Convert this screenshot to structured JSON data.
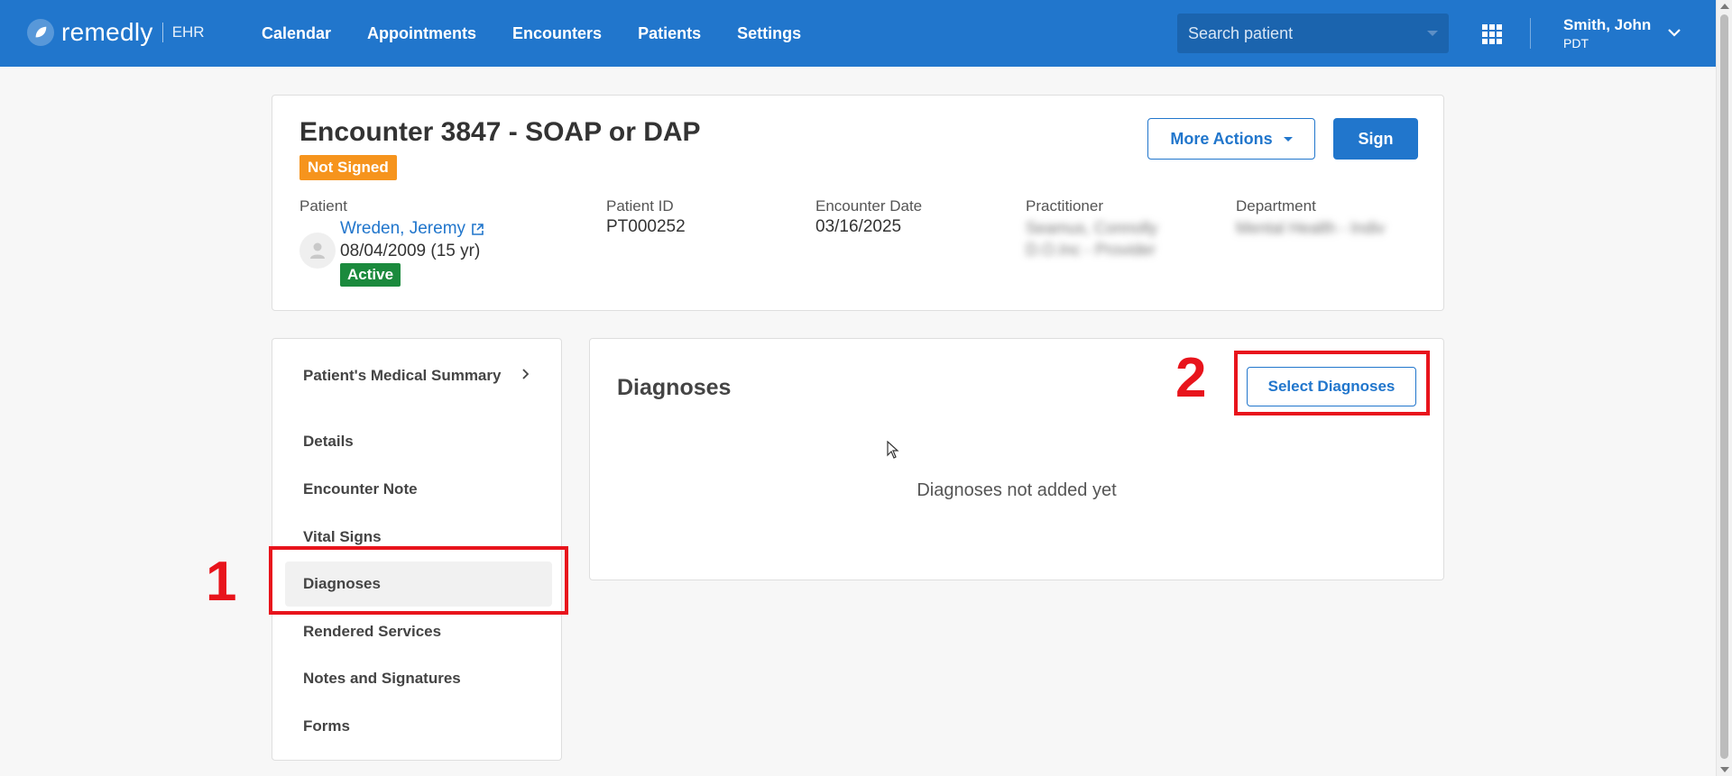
{
  "app": {
    "logo_text": "remedly",
    "logo_sub": "EHR"
  },
  "nav": {
    "items": [
      {
        "label": "Calendar"
      },
      {
        "label": "Appointments"
      },
      {
        "label": "Encounters"
      },
      {
        "label": "Patients"
      },
      {
        "label": "Settings"
      }
    ]
  },
  "search": {
    "placeholder": "Search patient"
  },
  "user": {
    "name": "Smith, John",
    "timezone": "PDT"
  },
  "encounter": {
    "title": "Encounter 3847 - SOAP or DAP",
    "status": "Not Signed",
    "more_actions_label": "More Actions",
    "sign_label": "Sign",
    "patient_label": "Patient",
    "patient_name": "Wreden, Jeremy",
    "patient_dob": "08/04/2009 (15 yr)",
    "patient_status": "Active",
    "patient_id_label": "Patient ID",
    "patient_id": "PT000252",
    "encounter_date_label": "Encounter Date",
    "encounter_date": "03/16/2025",
    "practitioner_label": "Practitioner",
    "practitioner_value": "Seamus, Connolly D.O.Inc - Provider",
    "department_label": "Department",
    "department_value": "Mental Health - Indiv"
  },
  "sidebar": {
    "items": [
      {
        "label": "Patient's Medical Summary"
      },
      {
        "label": "Details"
      },
      {
        "label": "Encounter Note"
      },
      {
        "label": "Vital Signs"
      },
      {
        "label": "Diagnoses"
      },
      {
        "label": "Rendered Services"
      },
      {
        "label": "Notes and Signatures"
      },
      {
        "label": "Forms"
      }
    ],
    "active_index": 4
  },
  "diagnoses": {
    "title": "Diagnoses",
    "select_button": "Select Diagnoses",
    "empty_message": "Diagnoses not added yet"
  },
  "annotations": {
    "step1": "1",
    "step2": "2"
  },
  "colors": {
    "brand": "#2176cc",
    "not_signed": "#f6941d",
    "active": "#1b8a3d",
    "annotation": "#e8141c"
  }
}
